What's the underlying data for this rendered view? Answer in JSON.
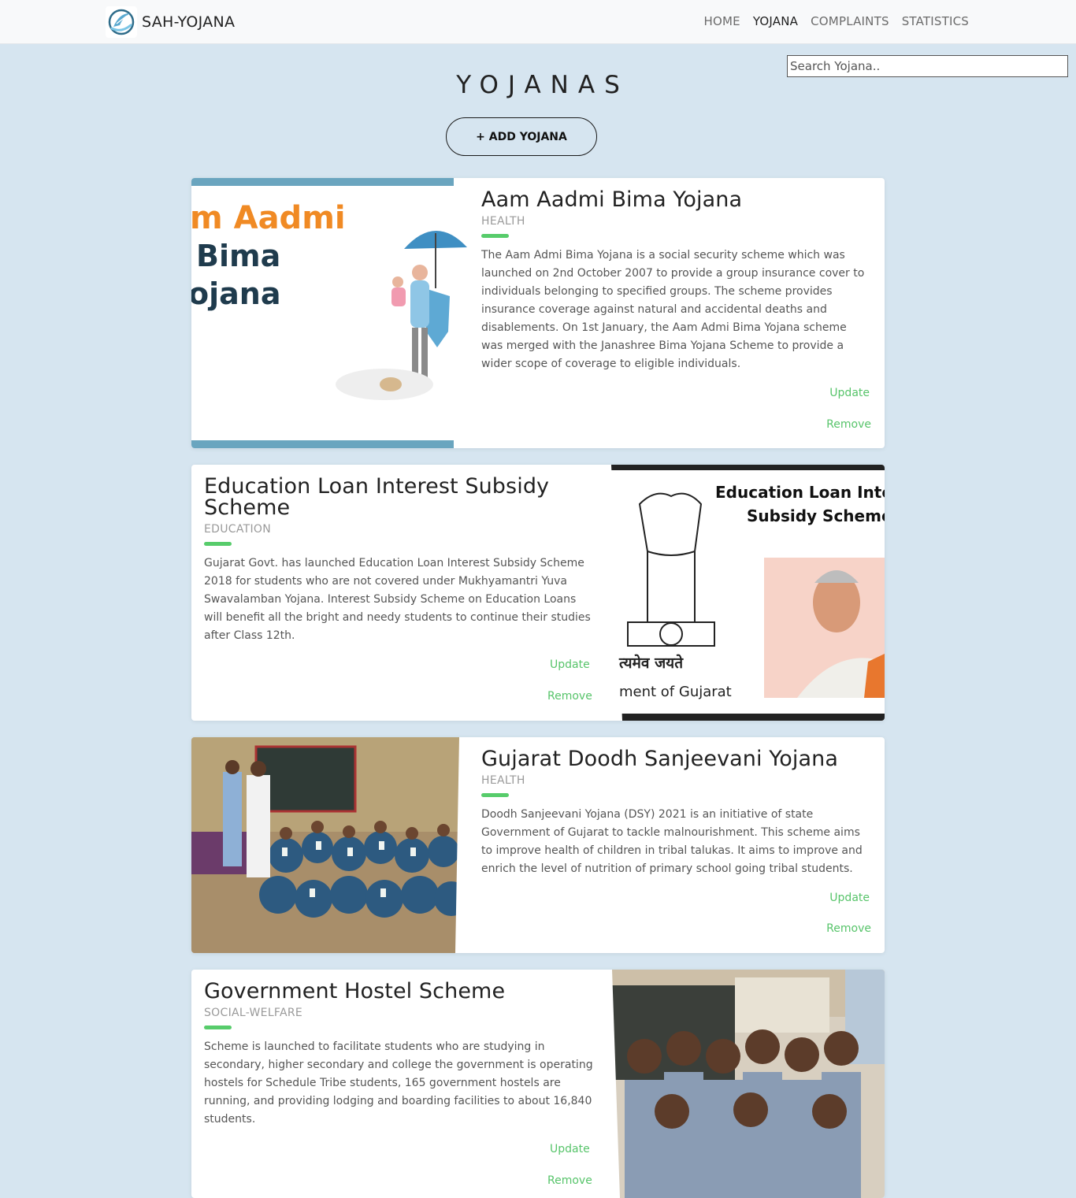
{
  "navbar": {
    "brand": "SAH-YOJANA",
    "links": [
      {
        "label": "HOME",
        "active": false
      },
      {
        "label": "YOJANA",
        "active": true
      },
      {
        "label": "COMPLAINTS",
        "active": false
      },
      {
        "label": "STATISTICS",
        "active": false
      }
    ]
  },
  "search": {
    "placeholder": "Search Yojana.."
  },
  "page": {
    "title": "YOJANAS",
    "add_button": "+ ADD YOJANA"
  },
  "cards": [
    {
      "title": "Aam Aadmi Bima Yojana",
      "category": "HEALTH",
      "description": "The Aam Admi Bima Yojana is a social security scheme which was launched on 2nd October 2007 to provide a group insurance cover to individuals belonging to specified groups. The scheme provides insurance coverage against natural and accidental deaths and disablements. On 1st January, the Aam Admi Bima Yojana scheme was merged with the Janashree Bima Yojana Scheme to provide a wider scope of coverage to eligible individuals.",
      "image_text": [
        "m Aadmi",
        "Bima",
        "ojana"
      ],
      "update": "Update",
      "remove": "Remove"
    },
    {
      "title": "Education Loan Interest Subsidy Scheme",
      "category": "EDUCATION",
      "description": "Gujarat Govt. has launched Education Loan Interest Subsidy Scheme 2018 for students who are not covered under Mukhyamantri Yuva Swavalamban Yojana. Interest Subsidy Scheme on Education Loans will benefit all the bright and needy students to continue their studies after Class 12th.",
      "image_text": [
        "Education Loan Inter",
        "Subsidy Scheme",
        "त्यमेव जयते",
        "ment of Gujarat"
      ],
      "update": "Update",
      "remove": "Remove"
    },
    {
      "title": "Gujarat Doodh Sanjeevani Yojana",
      "category": "HEALTH",
      "description": "Doodh Sanjeevani Yojana (DSY) 2021 is an initiative of state Government of Gujarat to tackle malnourishment. This scheme aims to improve health of children in tribal talukas. It aims to improve and enrich the level of nutrition of primary school going tribal students.",
      "update": "Update",
      "remove": "Remove"
    },
    {
      "title": "Government Hostel Scheme",
      "category": "SOCIAL-WELFARE",
      "description": "Scheme is launched to facilitate students who are studying in secondary, higher secondary and college the government is operating hostels for Schedule Tribe students, 165 government hostels are running, and providing lodging and boarding facilities to about 16,840 students.",
      "update": "Update",
      "remove": "Remove"
    }
  ]
}
